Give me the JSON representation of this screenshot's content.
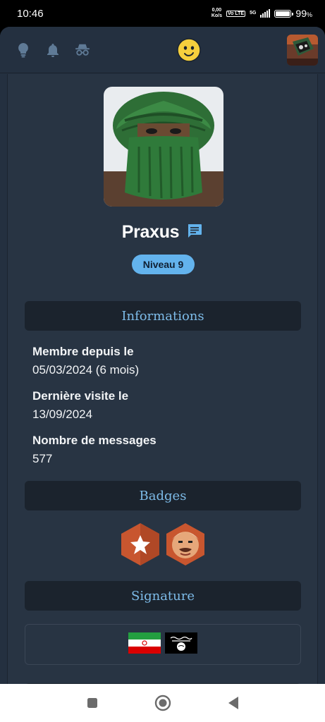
{
  "status_bar": {
    "time": "10:46",
    "net_speed_value": "0,00",
    "net_speed_unit": "Ko/s",
    "volte": "Vo LTE",
    "network": "5G",
    "battery_percent": "99",
    "battery_unit": "%",
    "battery_level": 0.99
  },
  "header": {
    "icons": [
      "lightbulb-icon",
      "bell-icon",
      "incognito-icon"
    ],
    "logo": "smiley-face-logo",
    "avatar": "user-avatar"
  },
  "profile": {
    "username": "Praxus",
    "message_icon": "chat-icon",
    "level": "Niveau 9"
  },
  "sections": {
    "informations": "Informations",
    "badges": "Badges",
    "signature": "Signature"
  },
  "info": {
    "member_since_label": "Membre depuis le",
    "member_since_value": "05/03/2024 (6 mois)",
    "last_visit_label": "Dernière visite le",
    "last_visit_value": "13/09/2024",
    "messages_label": "Nombre de messages",
    "messages_value": "577"
  },
  "badges": [
    "star-badge",
    "character-badge"
  ],
  "signature": {
    "images": [
      "iran-flag",
      "black-flag"
    ]
  },
  "colors": {
    "accent": "#63b3ed",
    "section_title": "#7dbbe8",
    "background": "#243040",
    "panel": "#1b232d"
  }
}
